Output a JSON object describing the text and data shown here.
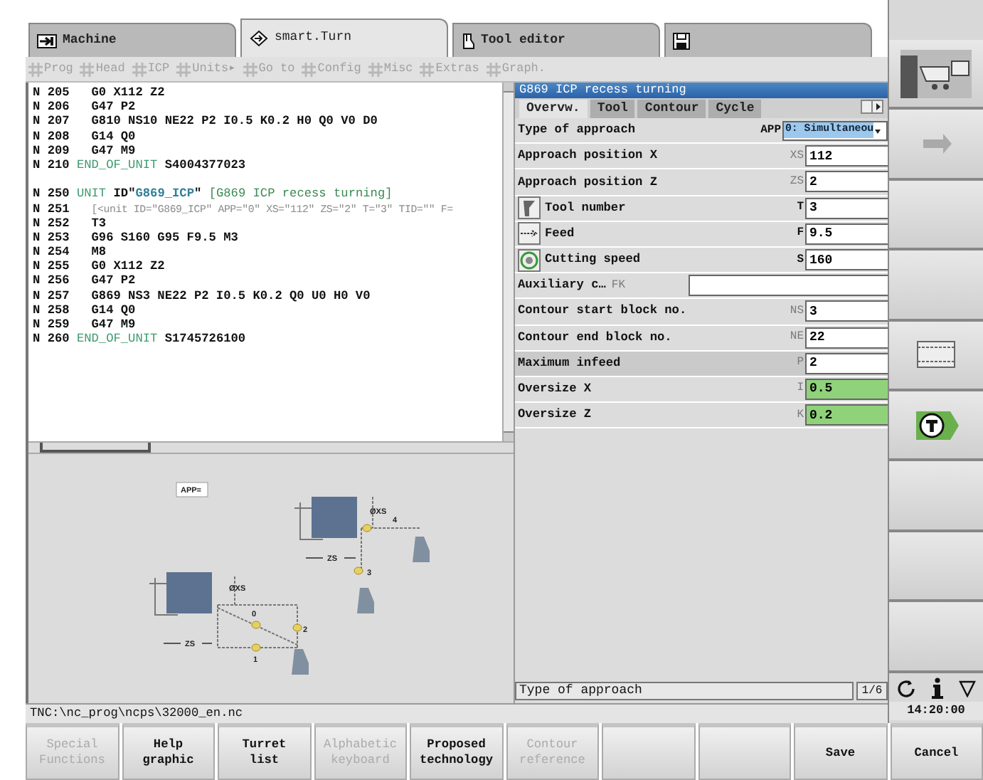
{
  "tabs": [
    {
      "label": "Machine",
      "selected": false
    },
    {
      "label": "smart.Turn",
      "selected": true
    },
    {
      "label": "Tool editor",
      "selected": false
    },
    {
      "selected": false
    }
  ],
  "menu": [
    "Prog",
    "Head",
    "ICP",
    "Units▸",
    "Go to",
    "Config",
    "Misc",
    "Extras",
    "Graph."
  ],
  "program": {
    "lines": [
      {
        "number": "N 205",
        "indent": true,
        "parts": [
          {
            "text": "G0 X112 Z2",
            "kind": "code"
          }
        ]
      },
      {
        "number": "N 206",
        "indent": true,
        "parts": [
          {
            "text": "G47 P2",
            "kind": "code"
          }
        ]
      },
      {
        "number": "N 207",
        "indent": true,
        "parts": [
          {
            "text": "G810 NS10 NE22 P2 I0.5 K0.2 H0 Q0 V0 D0",
            "kind": "code"
          }
        ]
      },
      {
        "number": "N 208",
        "indent": true,
        "parts": [
          {
            "text": "G14 Q0",
            "kind": "code"
          }
        ]
      },
      {
        "number": "N 209",
        "indent": true,
        "parts": [
          {
            "text": "G47 M9",
            "kind": "code"
          }
        ]
      },
      {
        "number": "N 210",
        "indent": false,
        "parts": [
          {
            "text": "END_OF_UNIT",
            "kind": "keyword"
          },
          {
            "text": " S4004377023",
            "kind": "code"
          }
        ]
      },
      {
        "number": "N 250",
        "indent": false,
        "gap_before": true,
        "parts": [
          {
            "text": "UNIT",
            "kind": "keyword"
          },
          {
            "text": " ID\"",
            "kind": "code"
          },
          {
            "text": "G869_ICP",
            "kind": "id"
          },
          {
            "text": "\" ",
            "kind": "code"
          },
          {
            "text": "[G869 ICP recess turning]",
            "kind": "comment"
          }
        ]
      },
      {
        "number": "N 251",
        "indent": true,
        "parts": [
          {
            "text": "[<unit ID=\"G869_ICP\" APP=\"0\" XS=\"112\" ZS=\"2\" T=\"3\" TID=\"\" F=",
            "kind": "xml"
          }
        ]
      },
      {
        "number": "N 252",
        "indent": true,
        "parts": [
          {
            "text": "T3",
            "kind": "code"
          }
        ]
      },
      {
        "number": "N 253",
        "indent": true,
        "parts": [
          {
            "text": "G96 S160 G95 F9.5 M3",
            "kind": "code"
          }
        ]
      },
      {
        "number": "N 254",
        "indent": true,
        "parts": [
          {
            "text": "M8",
            "kind": "code"
          }
        ]
      },
      {
        "number": "N 255",
        "indent": true,
        "parts": [
          {
            "text": "G0 X112 Z2",
            "kind": "code"
          }
        ]
      },
      {
        "number": "N 256",
        "indent": true,
        "parts": [
          {
            "text": "G47 P2",
            "kind": "code"
          }
        ]
      },
      {
        "number": "N 257",
        "indent": true,
        "parts": [
          {
            "text": "G869 NS3 NE22 P2 I0.5 K0.2 Q0 U0 H0 V0",
            "kind": "code"
          }
        ]
      },
      {
        "number": "N 258",
        "indent": true,
        "parts": [
          {
            "text": "G14 Q0",
            "kind": "code"
          }
        ]
      },
      {
        "number": "N 259",
        "indent": true,
        "parts": [
          {
            "text": "G47 M9",
            "kind": "code"
          }
        ]
      },
      {
        "number": "N 260",
        "indent": false,
        "parts": [
          {
            "text": "END_OF_UNIT",
            "kind": "keyword"
          },
          {
            "text": " S1745726100",
            "kind": "code"
          }
        ]
      }
    ]
  },
  "help_graphic": {
    "mode_label": "APP=",
    "upper": {
      "diameter": "ØXS",
      "z": "ZS",
      "points": [
        "4",
        "3"
      ]
    },
    "lower": {
      "diameter": "ØXS",
      "z": "ZS",
      "points": [
        "0",
        "2",
        "1"
      ]
    }
  },
  "dialog": {
    "title": "G869 ICP recess turning",
    "tabs": [
      {
        "label": "Overvw.",
        "selected": true
      },
      {
        "label": "Tool",
        "selected": false
      },
      {
        "label": "Contour",
        "selected": false
      },
      {
        "label": "Cycle",
        "selected": false
      }
    ],
    "rows": [
      {
        "kind": "select",
        "label": "Type of approach",
        "address": "APP",
        "address_muted": false,
        "value": "0: Simultaneou"
      },
      {
        "kind": "input",
        "label": "Approach position X",
        "address": "XS",
        "address_muted": true,
        "value": "112",
        "highlight": false
      },
      {
        "kind": "input",
        "label": "Approach position Z",
        "address": "ZS",
        "address_muted": true,
        "value": "2",
        "highlight": false
      },
      {
        "kind": "tool",
        "label": "Tool number",
        "address": "T",
        "address_muted": false,
        "value": "3",
        "highlight": false
      },
      {
        "kind": "feed",
        "label": "Feed",
        "address": "F",
        "address_muted": false,
        "value": "9.5",
        "highlight": false
      },
      {
        "kind": "speed",
        "label": "Cutting speed",
        "address": "S",
        "address_muted": false,
        "value": "160",
        "highlight": false
      },
      {
        "kind": "wide",
        "label": "Auxiliary c…",
        "address": "FK",
        "address_muted": true,
        "highlight": false
      },
      {
        "kind": "input",
        "label": "Contour start block no.",
        "address": "NS",
        "address_muted": true,
        "value": "3",
        "highlight": false
      },
      {
        "kind": "input",
        "label": "Contour end block no.",
        "address": "NE",
        "address_muted": true,
        "value": "22",
        "highlight": false
      },
      {
        "kind": "input",
        "label": "Maximum infeed",
        "address": "P",
        "address_muted": true,
        "value": "2",
        "highlight": false
      },
      {
        "kind": "input",
        "label": "Oversize X",
        "address": "I",
        "address_muted": true,
        "value": "0.5",
        "highlight": true
      },
      {
        "kind": "input",
        "label": "Oversize Z",
        "address": "K",
        "address_muted": true,
        "value": "0.2",
        "highlight": true
      }
    ],
    "help_text": "Type of approach",
    "page": "1/6"
  },
  "file_path": "TNC:\\nc_prog\\ncps\\32000_en.nc",
  "clock": "14:20:00",
  "softkeys": [
    {
      "kind": "label",
      "lines": [
        "Special",
        "Functions"
      ],
      "disabled": true
    },
    {
      "kind": "label",
      "lines": [
        "Help",
        "graphic"
      ],
      "disabled": false
    },
    {
      "kind": "label",
      "lines": [
        "Turret",
        "list"
      ],
      "disabled": false
    },
    {
      "kind": "label",
      "lines": [
        "Alphabetic",
        "keyboard"
      ],
      "disabled": true
    },
    {
      "kind": "label",
      "lines": [
        "Proposed",
        "technology"
      ],
      "disabled": false
    },
    {
      "kind": "label",
      "lines": [
        "Contour",
        "reference"
      ],
      "disabled": true
    },
    {
      "kind": "blank"
    },
    {
      "kind": "blank"
    },
    {
      "kind": "label",
      "lines": [
        "Save"
      ],
      "disabled": false
    },
    {
      "kind": "label",
      "lines": [
        "Cancel"
      ],
      "disabled": false
    }
  ]
}
